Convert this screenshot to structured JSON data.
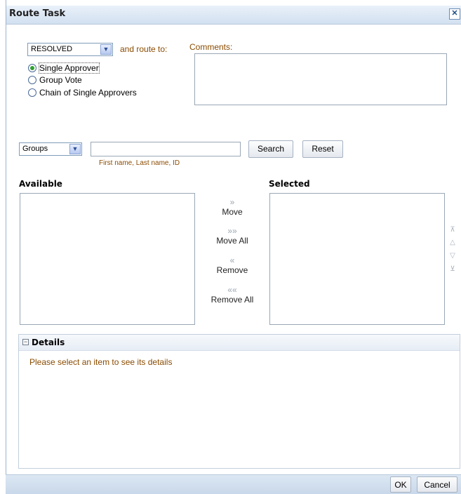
{
  "dialog": {
    "title": "Route Task",
    "close_icon": "close-icon"
  },
  "routing": {
    "outcome_value": "RESOLVED",
    "and_route_to": "and route to:",
    "comments_label": "Comments:",
    "options": [
      "Single Approver",
      "Group Vote",
      "Chain of Single Approvers"
    ],
    "selected_option": "Single Approver"
  },
  "search": {
    "type_value": "Groups",
    "hint": "First name, Last name, ID",
    "search_label": "Search",
    "reset_label": "Reset"
  },
  "shuttle": {
    "available_label": "Available",
    "selected_label": "Selected",
    "move": "Move",
    "move_all": "Move All",
    "remove": "Remove",
    "remove_all": "Remove All"
  },
  "details": {
    "title": "Details",
    "message": "Please select an item to see its details"
  },
  "footer": {
    "ok_label": "OK",
    "cancel_label": "Cancel"
  },
  "colors": {
    "brown_text": "#8a4b00",
    "title_bg": "#d2e0f0",
    "radio_selected": "#2ea12e"
  }
}
